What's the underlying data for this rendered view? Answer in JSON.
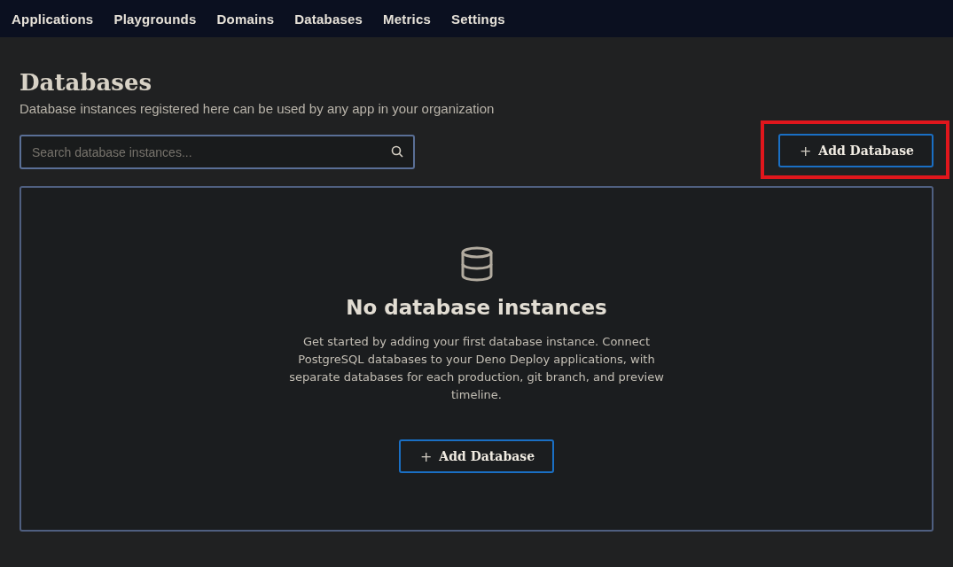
{
  "nav": {
    "items": [
      "Applications",
      "Playgrounds",
      "Domains",
      "Databases",
      "Metrics",
      "Settings"
    ]
  },
  "header": {
    "title": "Databases",
    "subtitle": "Database instances registered here can be used by any app in your organization"
  },
  "search": {
    "placeholder": "Search database instances..."
  },
  "add_button": {
    "icon": "+",
    "label": "Add Database",
    "highlighted": true
  },
  "empty_state": {
    "title": "No database instances",
    "description": "Get started by adding your first database instance. Connect PostgreSQL databases to your Deno Deploy applications, with separate databases for each production, git branch, and preview timeline.",
    "button": {
      "icon": "+",
      "label": "Add Database"
    }
  }
}
